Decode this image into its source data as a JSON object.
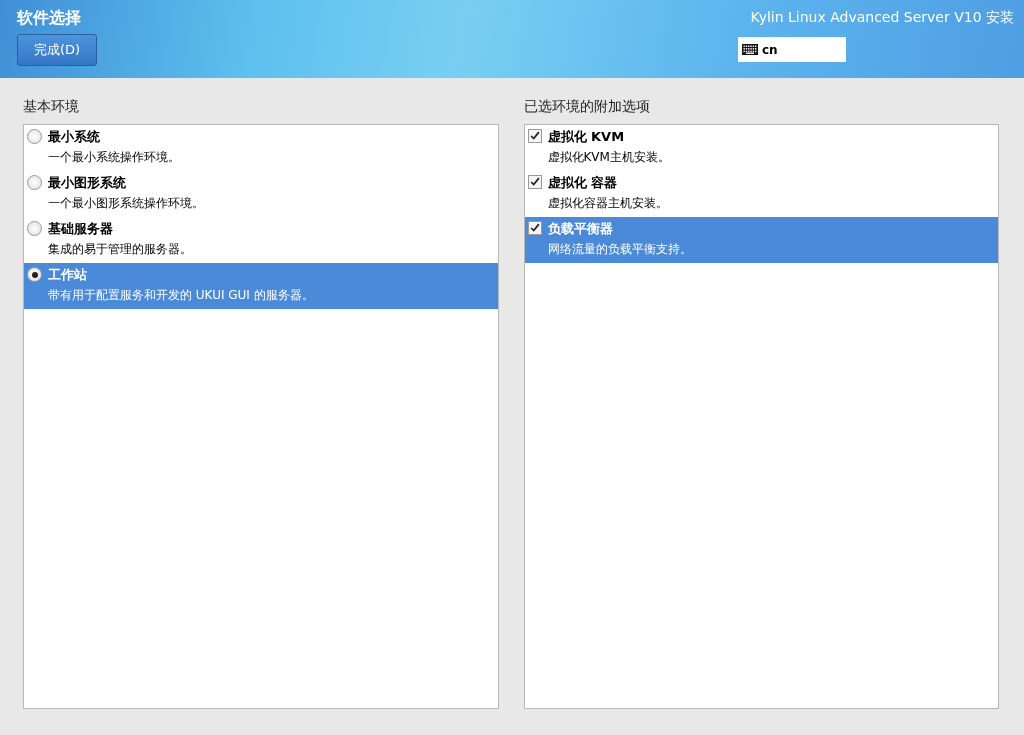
{
  "header": {
    "title": "软件选择",
    "done_button": "完成(D)",
    "product": "Kylin Linux Advanced Server V10 安装",
    "keyboard_layout": "cn"
  },
  "base_environment": {
    "heading": "基本环境",
    "items": [
      {
        "name": "最小系统",
        "description": "一个最小系统操作环境。",
        "checked": false,
        "selected": false
      },
      {
        "name": "最小图形系统",
        "description": "一个最小图形系统操作环境。",
        "checked": false,
        "selected": false
      },
      {
        "name": "基础服务器",
        "description": "集成的易于管理的服务器。",
        "checked": false,
        "selected": false
      },
      {
        "name": "工作站",
        "description": "带有用于配置服务和开发的 UKUI GUI 的服务器。",
        "checked": true,
        "selected": true
      }
    ]
  },
  "addons": {
    "heading": "已选环境的附加选项",
    "items": [
      {
        "name": "虚拟化 KVM",
        "description": "虚拟化KVM主机安装。",
        "checked": true,
        "selected": false
      },
      {
        "name": "虚拟化 容器",
        "description": "虚拟化容器主机安装。",
        "checked": true,
        "selected": false
      },
      {
        "name": "负载平衡器",
        "description": "网络流量的负载平衡支持。",
        "checked": true,
        "selected": true
      }
    ]
  }
}
